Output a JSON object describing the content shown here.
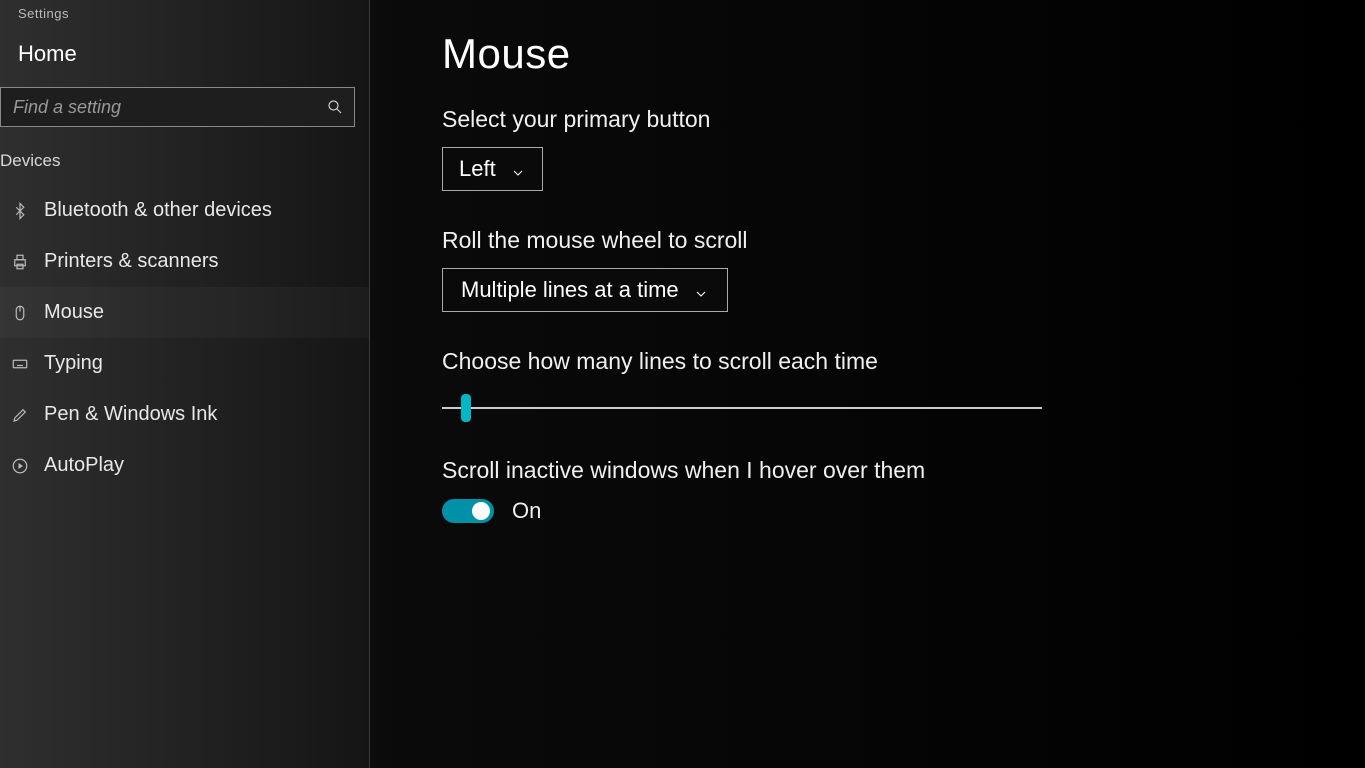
{
  "app_title": "Settings",
  "sidebar": {
    "home_label": "Home",
    "search_placeholder": "Find a setting",
    "category_label": "Devices",
    "items": [
      {
        "label": "Bluetooth & other devices"
      },
      {
        "label": "Printers & scanners"
      },
      {
        "label": "Mouse"
      },
      {
        "label": "Typing"
      },
      {
        "label": "Pen & Windows Ink"
      },
      {
        "label": "AutoPlay"
      }
    ]
  },
  "main": {
    "page_title": "Mouse",
    "primary_button": {
      "label": "Select your primary button",
      "value": "Left"
    },
    "wheel_scroll": {
      "label": "Roll the mouse wheel to scroll",
      "value": "Multiple lines at a time"
    },
    "lines_slider": {
      "label": "Choose how many lines to scroll each time"
    },
    "inactive_scroll": {
      "label": "Scroll inactive windows when I hover over them",
      "state_label": "On"
    }
  },
  "colors": {
    "accent": "#00b7c3"
  }
}
